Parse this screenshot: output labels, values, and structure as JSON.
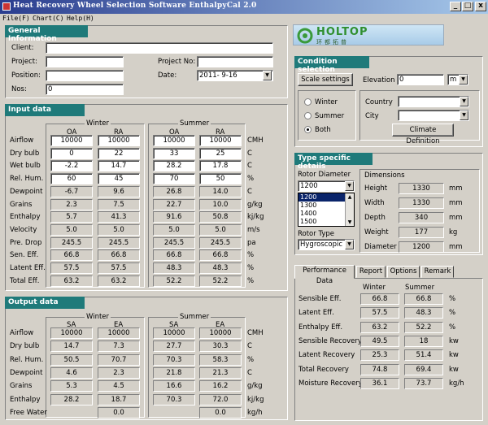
{
  "window": {
    "title": "Heat Recovery Wheel Selection Software EnthalpyCal 2.0",
    "min": "_",
    "max": "□",
    "close": "x"
  },
  "menu": [
    "File(F)",
    "Chart(C)",
    "Help(H)"
  ],
  "logo": {
    "brand": "HOLTOP",
    "chinese": "环都拓普"
  },
  "general": {
    "title": "General Information",
    "client_label": "Client:",
    "client": "",
    "project_label": "Project:",
    "project": "",
    "position_label": "Position:",
    "position": "",
    "nos_label": "Nos:",
    "nos": "0",
    "project_no_label": "Project No:",
    "project_no": "",
    "date_label": "Date:",
    "date": "2011- 9-16"
  },
  "input": {
    "title": "Input data",
    "winter": "Winter",
    "summer": "Summer",
    "cols": [
      "OA",
      "RA",
      "OA",
      "RA"
    ],
    "rows": [
      {
        "label": "Airflow",
        "vals": [
          "10000",
          "10000",
          "10000",
          "10000"
        ],
        "unit": "CMH"
      },
      {
        "label": "Dry bulb",
        "vals": [
          "0",
          "22",
          "33",
          "25"
        ],
        "unit": "C"
      },
      {
        "label": "Wet bulb",
        "vals": [
          "-2.2",
          "14.7",
          "28.2",
          "17.8"
        ],
        "unit": "C"
      },
      {
        "label": "Rel. Hum.",
        "vals": [
          "60",
          "45",
          "70",
          "50"
        ],
        "unit": "%"
      },
      {
        "label": "Dewpoint",
        "vals": [
          "-6.7",
          "9.6",
          "26.8",
          "14.0"
        ],
        "unit": "C"
      },
      {
        "label": "Grains",
        "vals": [
          "2.3",
          "7.5",
          "22.7",
          "10.0"
        ],
        "unit": "g/kg"
      },
      {
        "label": "Enthalpy",
        "vals": [
          "5.7",
          "41.3",
          "91.6",
          "50.8"
        ],
        "unit": "kj/kg"
      },
      {
        "label": "Velocity",
        "vals": [
          "5.0",
          "5.0",
          "5.0",
          "5.0"
        ],
        "unit": "m/s"
      },
      {
        "label": "Pre. Drop",
        "vals": [
          "245.5",
          "245.5",
          "245.5",
          "245.5"
        ],
        "unit": "pa"
      },
      {
        "label": "Sen. Eff.",
        "vals": [
          "66.8",
          "66.8",
          "66.8",
          "66.8"
        ],
        "unit": "%"
      },
      {
        "label": "Latent Eff.",
        "vals": [
          "57.5",
          "57.5",
          "48.3",
          "48.3"
        ],
        "unit": "%"
      },
      {
        "label": "Total Eff.",
        "vals": [
          "63.2",
          "63.2",
          "52.2",
          "52.2"
        ],
        "unit": "%"
      }
    ]
  },
  "output": {
    "title": "Output data",
    "winter": "Winter",
    "summer": "Summer",
    "cols": [
      "SA",
      "EA",
      "SA",
      "EA"
    ],
    "rows": [
      {
        "label": "Airflow",
        "vals": [
          "10000",
          "10000",
          "10000",
          "10000"
        ],
        "unit": "CMH"
      },
      {
        "label": "Dry bulb",
        "vals": [
          "14.7",
          "7.3",
          "27.7",
          "30.3"
        ],
        "unit": "C"
      },
      {
        "label": "Rel. Hum.",
        "vals": [
          "50.5",
          "70.7",
          "70.3",
          "58.3"
        ],
        "unit": "%"
      },
      {
        "label": "Dewpoint",
        "vals": [
          "4.6",
          "2.3",
          "21.8",
          "21.3"
        ],
        "unit": "C"
      },
      {
        "label": "Grains",
        "vals": [
          "5.3",
          "4.5",
          "16.6",
          "16.2"
        ],
        "unit": "g/kg"
      },
      {
        "label": "Enthalpy",
        "vals": [
          "28.2",
          "18.7",
          "70.3",
          "72.0"
        ],
        "unit": "kj/kg"
      },
      {
        "label": "Free Water",
        "vals": [
          "",
          "0.0",
          "",
          "0.0"
        ],
        "unit": "kg/h"
      }
    ]
  },
  "condition": {
    "title": "Condition selection",
    "scale_btn": "Scale settings",
    "elevation_label": "Elevation",
    "elevation": "0",
    "elevation_unit": "m",
    "season": [
      "Winter",
      "Summer",
      "Both"
    ],
    "country_label": "Country",
    "country": "",
    "city_label": "City",
    "city": "",
    "climate_btn": "Climate Definition"
  },
  "type": {
    "title": "Type specific details",
    "rotor_diam_label": "Rotor Diameter",
    "rotor_diam": "1200",
    "rotor_list": [
      "1200",
      "1300",
      "1400",
      "1500"
    ],
    "rotor_type_label": "Rotor Type",
    "rotor_type": "Hygroscopic",
    "dimensions_label": "Dimensions",
    "dims": [
      {
        "label": "Height",
        "value": "1330",
        "unit": "mm"
      },
      {
        "label": "Width",
        "value": "1330",
        "unit": "mm"
      },
      {
        "label": "Depth",
        "value": "340",
        "unit": "mm"
      },
      {
        "label": "Weight",
        "value": "177",
        "unit": "kg"
      },
      {
        "label": "Diameter",
        "value": "1200",
        "unit": "mm"
      }
    ]
  },
  "perf": {
    "tabs": [
      "Performance Data",
      "Report",
      "Options",
      "Remark"
    ],
    "winter": "Winter",
    "summer": "Summer",
    "rows": [
      {
        "label": "Sensible Eff.",
        "w": "66.8",
        "s": "66.8",
        "unit": "%"
      },
      {
        "label": "Latent Eff.",
        "w": "57.5",
        "s": "48.3",
        "unit": "%"
      },
      {
        "label": "Enthalpy Eff.",
        "w": "63.2",
        "s": "52.2",
        "unit": "%"
      },
      {
        "label": "Sensible Recovery",
        "w": "49.5",
        "s": "18",
        "unit": "kw"
      },
      {
        "label": "Latent Recovery",
        "w": "25.3",
        "s": "51.4",
        "unit": "kw"
      },
      {
        "label": "Total Recovery",
        "w": "74.8",
        "s": "69.4",
        "unit": "kw"
      },
      {
        "label": "Moisture Recovery",
        "w": "36.1",
        "s": "73.7",
        "unit": "kg/h"
      }
    ]
  }
}
